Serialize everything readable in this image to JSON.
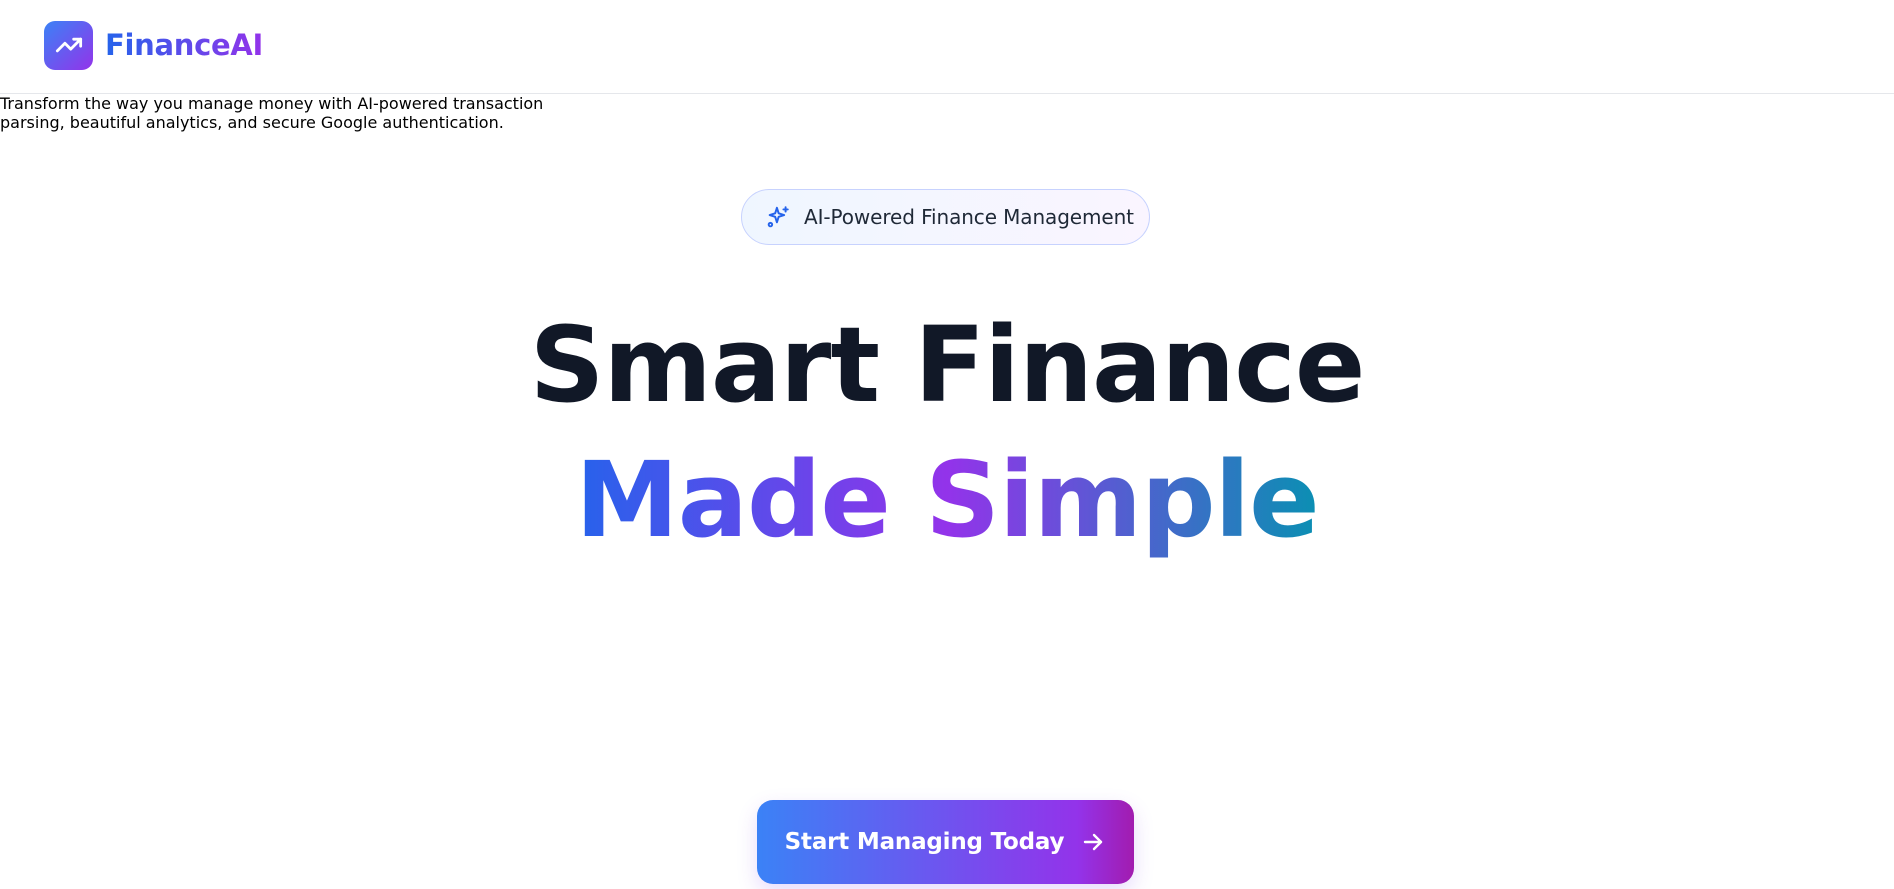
{
  "header": {
    "brand_name": "FinanceAI",
    "logo_icon": "trending-up-icon"
  },
  "hero": {
    "badge": {
      "icon": "sparkles-icon",
      "label": "AI-Powered Finance Management"
    },
    "headline_line1": "Smart Finance",
    "headline_line2": "Made Simple",
    "subtitle_line1": "Transform the way you manage money with AI-powered transaction",
    "subtitle_line2": "parsing, beautiful analytics, and secure Google authentication.",
    "cta": {
      "label": "Start Managing Today",
      "icon": "arrow-right-icon"
    }
  },
  "colors": {
    "brand_gradient_start": "#3b82f6",
    "brand_gradient_end": "#9333ea",
    "headline_dark": "#111827",
    "subtitle_gray": "#4b5563",
    "accent_teal": "#0891b2"
  }
}
